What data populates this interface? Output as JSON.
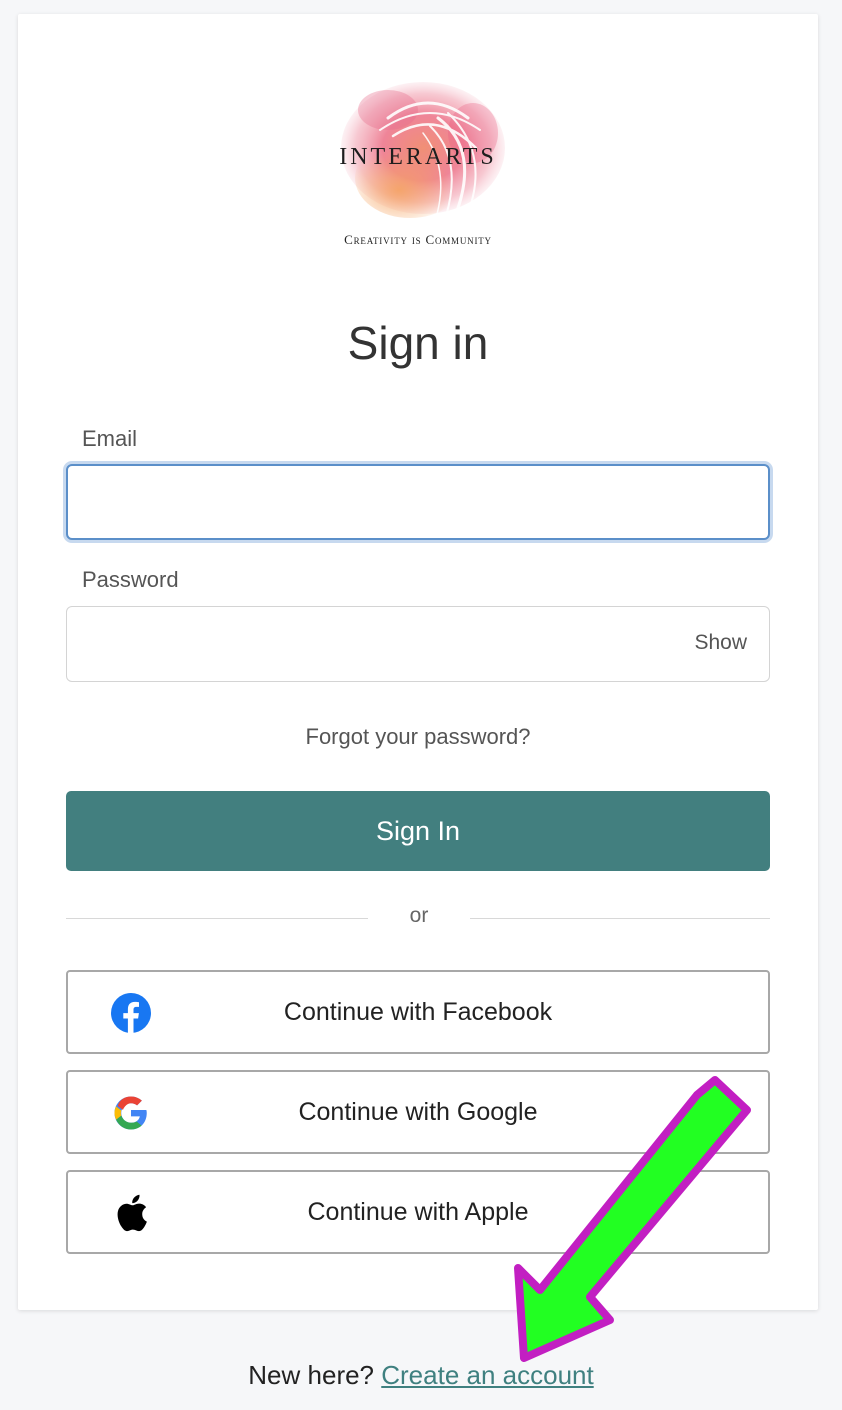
{
  "logo": {
    "title": "INTERARTS",
    "tagline": "Creativity is Community"
  },
  "page": {
    "title": "Sign in"
  },
  "form": {
    "email_label": "Email",
    "email_value": "",
    "password_label": "Password",
    "password_value": "",
    "show_label": "Show",
    "forgot_label": "Forgot your password?",
    "submit_label": "Sign In"
  },
  "divider": {
    "text": "or"
  },
  "social": {
    "facebook_label": "Continue with Facebook",
    "google_label": "Continue with Google",
    "apple_label": "Continue with Apple"
  },
  "footer": {
    "prompt": "New here?",
    "link_label": "Create an account"
  },
  "colors": {
    "primary": "#427f7f",
    "link": "#3f8080",
    "focus_border": "#5b8fc9",
    "facebook": "#1877f2",
    "annotation_arrow_fill": "#22ff22",
    "annotation_arrow_stroke": "#c21fc2"
  },
  "icons": {
    "facebook": "facebook-icon",
    "google": "google-icon",
    "apple": "apple-icon"
  }
}
